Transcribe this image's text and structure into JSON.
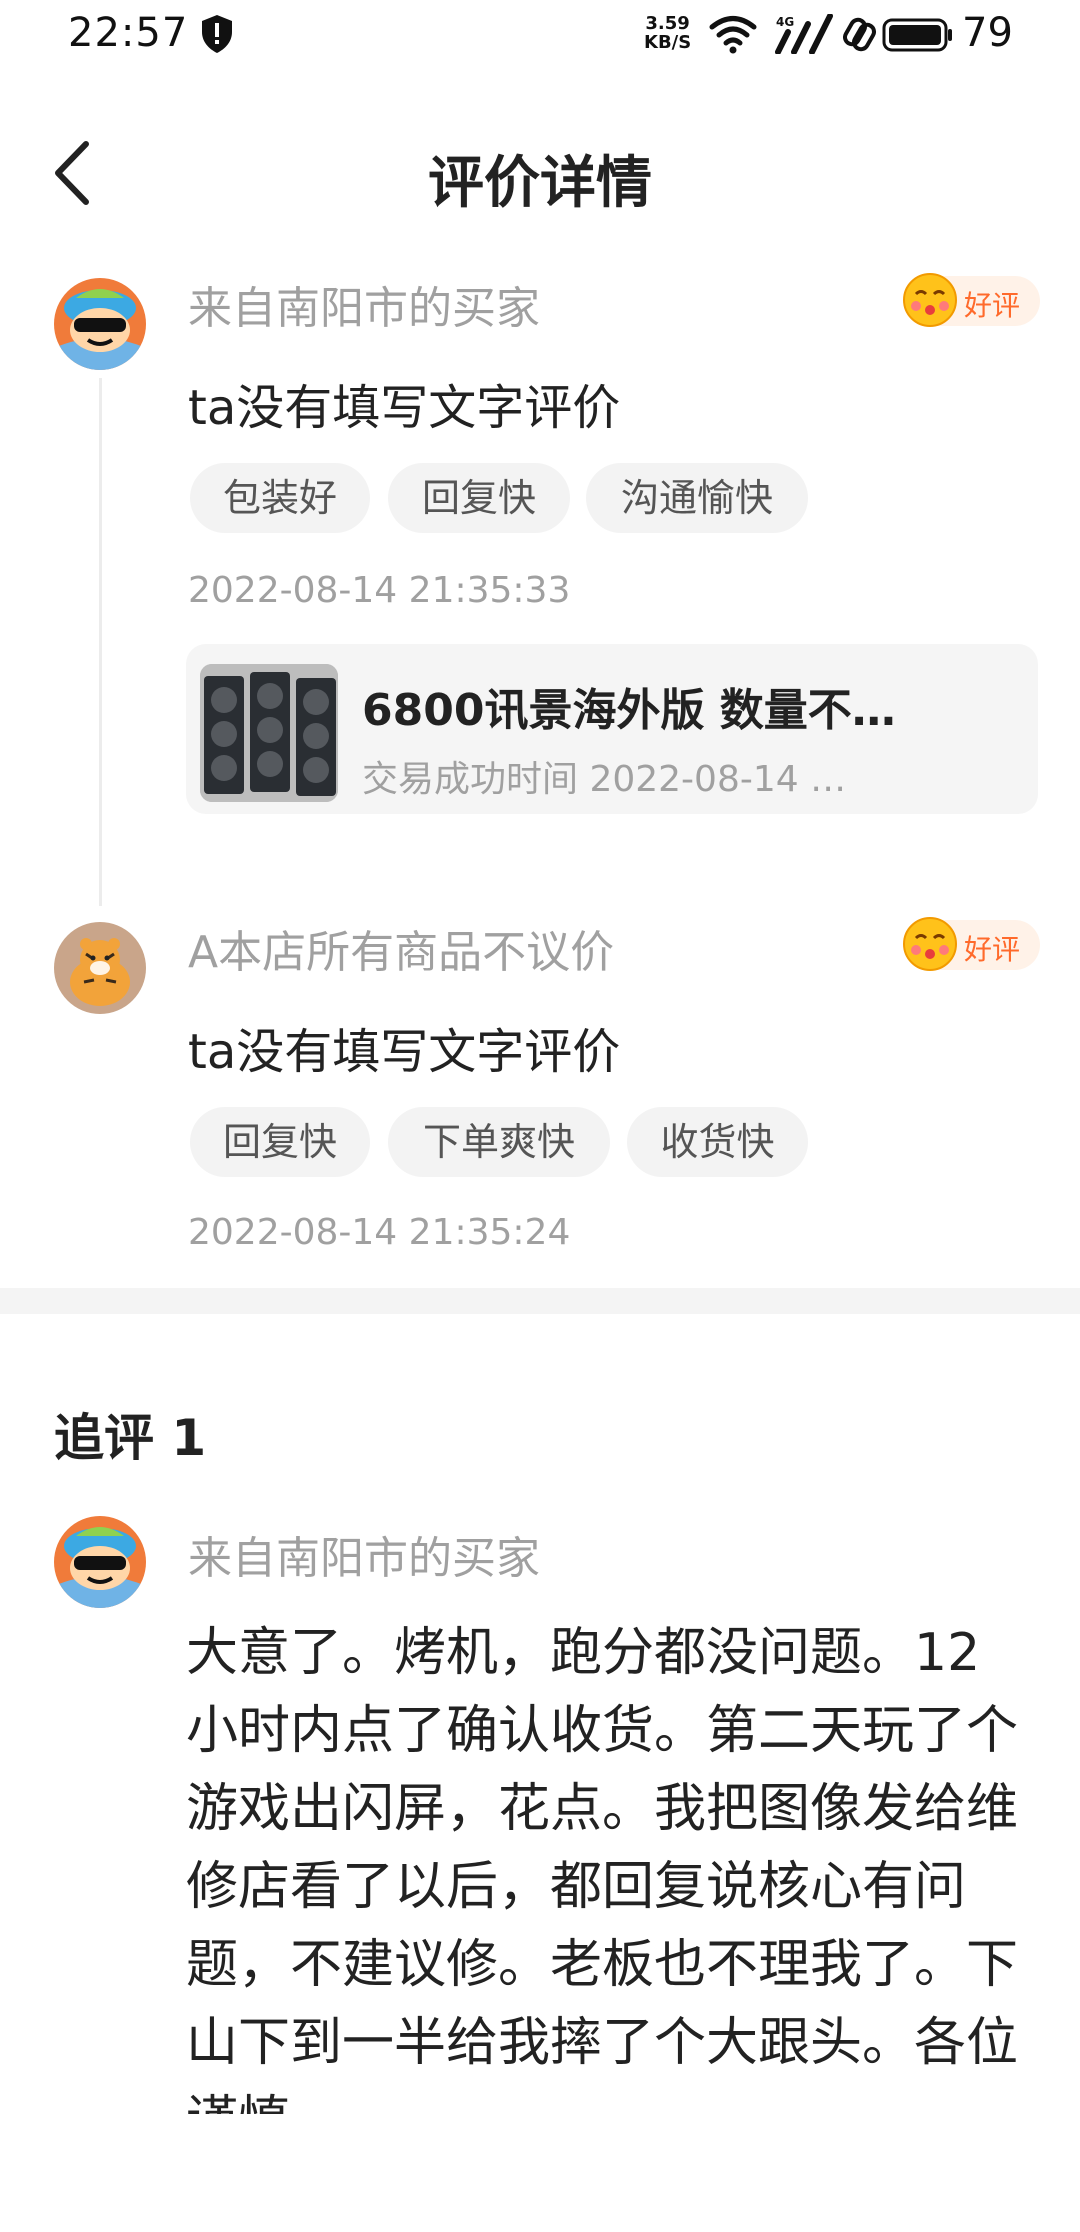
{
  "status_bar": {
    "time": "22:57",
    "speed_value": "3.59",
    "speed_unit": "KB/S",
    "battery": "79"
  },
  "header": {
    "title": "评价详情"
  },
  "reviews": [
    {
      "name": "来自南阳市的买家",
      "rating_label": "好评",
      "text": "ta没有填写文字评价",
      "tags": [
        "包装好",
        "回复快",
        "沟通愉快"
      ],
      "timestamp": "2022-08-14 21:35:33",
      "product": {
        "title": "6800讯景海外版 数量不…",
        "trade_time": "交易成功时间 2022-08-14 …"
      }
    },
    {
      "name": "A本店所有商品不议价",
      "rating_label": "好评",
      "text": "ta没有填写文字评价",
      "tags": [
        "回复快",
        "下单爽快",
        "收货快"
      ],
      "timestamp": "2022-08-14 21:35:24"
    }
  ],
  "followup": {
    "section_title": "追评 1",
    "name": "来自南阳市的买家",
    "text": "大意了。烤机，跑分都没问题。12小时内点了确认收货。第二天玩了个游戏出闪屏，花点。我把图像发给维修店看了以后，都回复说核心有问题，不建议修。老板也不理我了。下山下到一半给我摔了个大跟头。各位谨慎"
  },
  "colors": {
    "accent": "#ff6a2b",
    "badge_bg": "#fff2e8",
    "secondary_text": "#a0a0a0",
    "tag_bg": "#f3f3f3"
  },
  "icons": [
    "shield-icon",
    "wifi-icon",
    "4g-signal-icon",
    "link-icon",
    "battery-icon",
    "back-arrow-icon",
    "smile-face-icon"
  ]
}
